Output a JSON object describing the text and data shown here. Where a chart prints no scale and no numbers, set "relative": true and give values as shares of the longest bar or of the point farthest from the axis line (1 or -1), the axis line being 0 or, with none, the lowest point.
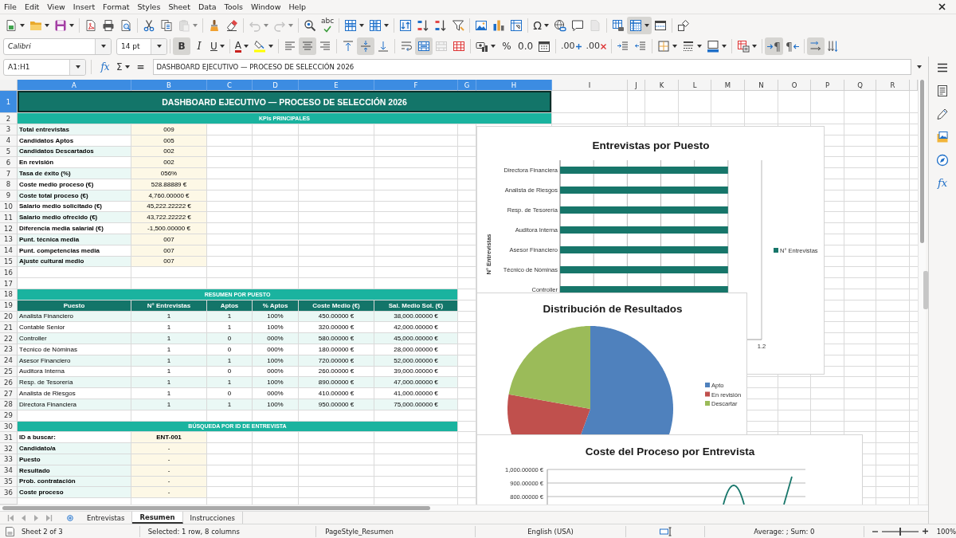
{
  "menu_bar": {
    "items": [
      "File",
      "Edit",
      "View",
      "Insert",
      "Format",
      "Styles",
      "Sheet",
      "Data",
      "Tools",
      "Window",
      "Help"
    ]
  },
  "standard_toolbar": [
    [
      {
        "kind": "new",
        "pressed": false,
        "disabled": false
      },
      {
        "kind": "open",
        "pressed": false,
        "disabled": false
      },
      {
        "kind": "save",
        "pressed": false,
        "disabled": false
      }
    ],
    [
      {
        "kind": "export_pdf",
        "pressed": false,
        "disabled": false
      },
      {
        "kind": "print",
        "pressed": false,
        "disabled": false
      },
      {
        "kind": "print_preview",
        "pressed": false,
        "disabled": false
      }
    ],
    [
      {
        "kind": "cut",
        "pressed": false,
        "disabled": false
      },
      {
        "kind": "copy",
        "pressed": false,
        "disabled": false
      },
      {
        "kind": "paste",
        "pressed": false,
        "disabled": true
      }
    ],
    [
      {
        "kind": "clone_formatting",
        "pressed": false,
        "disabled": false
      },
      {
        "kind": "clear_formatting",
        "pressed": false,
        "disabled": false
      }
    ],
    [
      {
        "kind": "undo",
        "pressed": false,
        "disabled": true
      },
      {
        "kind": "redo",
        "pressed": false,
        "disabled": true
      }
    ],
    [
      {
        "kind": "find_replace",
        "pressed": false,
        "disabled": false
      },
      {
        "kind": "spelling",
        "glyph": "abc",
        "pressed": false,
        "disabled": false
      }
    ],
    [
      {
        "kind": "insert_row",
        "pressed": false,
        "disabled": false
      },
      {
        "kind": "insert_column",
        "pressed": false,
        "disabled": false
      }
    ],
    [
      {
        "kind": "sort",
        "pressed": false,
        "disabled": false
      },
      {
        "kind": "sort_ascending",
        "pressed": false,
        "disabled": false
      },
      {
        "kind": "sort_descending",
        "pressed": false,
        "disabled": false
      },
      {
        "kind": "autofilter",
        "pressed": false,
        "disabled": false
      }
    ],
    [
      {
        "kind": "image",
        "pressed": false,
        "disabled": false
      },
      {
        "kind": "chart",
        "pressed": false,
        "disabled": false
      },
      {
        "kind": "pivot_table",
        "pressed": false,
        "disabled": false
      }
    ],
    [
      {
        "kind": "special_character",
        "glyph": "Ω",
        "pressed": false,
        "disabled": false
      },
      {
        "kind": "hyperlink",
        "pressed": false,
        "disabled": false
      },
      {
        "kind": "comment",
        "pressed": false,
        "disabled": false
      },
      {
        "kind": "header_footer",
        "pressed": false,
        "disabled": true
      }
    ],
    [
      {
        "kind": "print_area",
        "pressed": false,
        "disabled": false
      },
      {
        "kind": "freeze",
        "pressed": true,
        "disabled": false
      },
      {
        "kind": "split_window",
        "pressed": false,
        "disabled": false
      }
    ],
    [
      {
        "kind": "draw_functions",
        "pressed": false,
        "disabled": false
      }
    ]
  ],
  "formatting_toolbar": {
    "font_name": "Calibri",
    "font_size": "14 pt",
    "groups": [
      [
        {
          "kind": "bold",
          "glyph": "B",
          "pressed": true,
          "disabled": false
        },
        {
          "kind": "italic",
          "glyph": "I",
          "pressed": false,
          "disabled": false
        },
        {
          "kind": "underline",
          "glyph": "U",
          "pressed": false,
          "disabled": false
        }
      ],
      [
        {
          "kind": "font_color",
          "glyph": "A",
          "pressed": false,
          "disabled": false
        },
        {
          "kind": "highlight",
          "pressed": false,
          "disabled": false
        }
      ],
      [
        {
          "kind": "align_left",
          "pressed": false,
          "disabled": false
        },
        {
          "kind": "align_center",
          "pressed": true,
          "disabled": false
        },
        {
          "kind": "align_right",
          "pressed": false,
          "disabled": false
        }
      ],
      [
        {
          "kind": "align_top",
          "pressed": false,
          "disabled": false
        },
        {
          "kind": "align_middle",
          "pressed": true,
          "disabled": false
        },
        {
          "kind": "align_bottom",
          "pressed": false,
          "disabled": false
        }
      ],
      [
        {
          "kind": "wrap_text",
          "pressed": false,
          "disabled": false
        },
        {
          "kind": "merge_center",
          "pressed": true,
          "disabled": false
        },
        {
          "kind": "merge_cells",
          "pressed": false,
          "disabled": true
        },
        {
          "kind": "unmerge",
          "pressed": false,
          "disabled": false
        }
      ],
      [
        {
          "kind": "number_format",
          "pressed": false,
          "disabled": false
        },
        {
          "kind": "percent",
          "glyph": "%",
          "pressed": false,
          "disabled": false
        },
        {
          "kind": "number",
          "glyph": "0.0",
          "pressed": false,
          "disabled": false
        },
        {
          "kind": "date",
          "pressed": false,
          "disabled": false
        }
      ],
      [
        {
          "kind": "add_decimal",
          "glyph": ".00",
          "pressed": false,
          "disabled": false
        },
        {
          "kind": "delete_decimal",
          "glyph": ".00",
          "pressed": false,
          "disabled": false
        }
      ],
      [
        {
          "kind": "indent_increase",
          "pressed": false,
          "disabled": false
        },
        {
          "kind": "indent_decrease",
          "pressed": false,
          "disabled": false
        }
      ],
      [
        {
          "kind": "borders",
          "pressed": false,
          "disabled": false
        },
        {
          "kind": "border_style",
          "pressed": false,
          "disabled": false
        },
        {
          "kind": "border_color",
          "pressed": false,
          "disabled": false
        }
      ],
      [
        {
          "kind": "conditional",
          "pressed": false,
          "disabled": false
        }
      ],
      [
        {
          "kind": "left_to_right",
          "glyph": "¶",
          "pressed": true,
          "disabled": false
        },
        {
          "kind": "right_to_left",
          "glyph": "¶",
          "pressed": false,
          "disabled": false
        }
      ],
      [
        {
          "kind": "text_horizontal",
          "pressed": true,
          "disabled": false
        },
        {
          "kind": "text_vertical",
          "pressed": false,
          "disabled": false
        }
      ]
    ]
  },
  "formula_bar": {
    "name_box": "A1:H1",
    "buttons": [
      {
        "kind": "function_wizard",
        "glyph": "fx"
      },
      {
        "kind": "sum",
        "glyph": "Σ"
      },
      {
        "kind": "formula",
        "glyph": "="
      }
    ],
    "content": "DASHBOARD EJECUTIVO — PROCESO DE SELECCIÓN 2026"
  },
  "sheet": {
    "columns": [
      {
        "label": "A",
        "selected": true
      },
      {
        "label": "B",
        "selected": true
      },
      {
        "label": "C",
        "selected": true
      },
      {
        "label": "D",
        "selected": true
      },
      {
        "label": "E",
        "selected": true
      },
      {
        "label": "F",
        "selected": true
      },
      {
        "label": "G",
        "selected": true
      },
      {
        "label": "H",
        "selected": true
      },
      {
        "label": "I",
        "selected": false
      },
      {
        "label": "J",
        "selected": false
      },
      {
        "label": "K",
        "selected": false
      },
      {
        "label": "L",
        "selected": false
      },
      {
        "label": "M",
        "selected": false
      },
      {
        "label": "N",
        "selected": false
      },
      {
        "label": "O",
        "selected": false
      },
      {
        "label": "P",
        "selected": false
      },
      {
        "label": "Q",
        "selected": false
      },
      {
        "label": "R",
        "selected": false
      }
    ],
    "rows": [
      {
        "label": "1",
        "selected": true
      },
      {
        "label": "2",
        "selected": false
      },
      {
        "label": "3",
        "selected": false
      },
      {
        "label": "4",
        "selected": false
      },
      {
        "label": "5",
        "selected": false
      },
      {
        "label": "6",
        "selected": false
      },
      {
        "label": "7",
        "selected": false
      },
      {
        "label": "8",
        "selected": false
      },
      {
        "label": "9",
        "selected": false
      },
      {
        "label": "10",
        "selected": false
      },
      {
        "label": "11",
        "selected": false
      },
      {
        "label": "12",
        "selected": false
      },
      {
        "label": "13",
        "selected": false
      },
      {
        "label": "14",
        "selected": false
      },
      {
        "label": "15",
        "selected": false
      },
      {
        "label": "16",
        "selected": false
      },
      {
        "label": "17",
        "selected": false
      },
      {
        "label": "18",
        "selected": false
      },
      {
        "label": "19",
        "selected": false
      },
      {
        "label": "20",
        "selected": false
      },
      {
        "label": "21",
        "selected": false
      },
      {
        "label": "22",
        "selected": false
      },
      {
        "label": "23",
        "selected": false
      },
      {
        "label": "24",
        "selected": false
      },
      {
        "label": "25",
        "selected": false
      },
      {
        "label": "26",
        "selected": false
      },
      {
        "label": "27",
        "selected": false
      },
      {
        "label": "28",
        "selected": false
      },
      {
        "label": "29",
        "selected": false
      },
      {
        "label": "30",
        "selected": false
      },
      {
        "label": "31",
        "selected": false
      },
      {
        "label": "32",
        "selected": false
      },
      {
        "label": "33",
        "selected": false
      },
      {
        "label": "34",
        "selected": false
      },
      {
        "label": "35",
        "selected": false
      },
      {
        "label": "36",
        "selected": false
      }
    ],
    "title": "DASHBOARD EJECUTIVO — PROCESO DE SELECCIÓN 2026",
    "kpis": {
      "heading": "KPIs PRINCIPALES",
      "items": [
        {
          "label": "Total entrevistas",
          "value": "009"
        },
        {
          "label": "Candidatos Aptos",
          "value": "005"
        },
        {
          "label": "Candidatos Descartados",
          "value": "002"
        },
        {
          "label": "En revisión",
          "value": "002"
        },
        {
          "label": "Tasa de éxito (%)",
          "value": "056%"
        },
        {
          "label": "Coste medio proceso (€)",
          "value": "528.88889 €"
        },
        {
          "label": "Coste total proceso (€)",
          "value": "4,760.00000 €"
        },
        {
          "label": "Salario medio solicitado (€)",
          "value": "45,222.22222 €"
        },
        {
          "label": "Salario medio ofrecido (€)",
          "value": "43,722.22222 €"
        },
        {
          "label": "Diferencia media salarial (€)",
          "value": "-1,500.00000 €"
        },
        {
          "label": "Punt. técnica media",
          "value": "007"
        },
        {
          "label": "Punt. competencias media",
          "value": "007"
        },
        {
          "label": "Ajuste cultural medio",
          "value": "007"
        }
      ]
    },
    "summary": {
      "heading": "RESUMEN POR PUESTO",
      "columns": [
        "Puesto",
        "N° Entrevistas",
        "Aptos",
        "% Aptos",
        "Coste Medio (€)",
        "Sal. Medio Sol. (€)"
      ],
      "rows": [
        [
          "Analista Financiero",
          "1",
          "1",
          "100%",
          "450.00000 €",
          "38,000.00000 €"
        ],
        [
          "Contable Senior",
          "1",
          "1",
          "100%",
          "320.00000 €",
          "42,000.00000 €"
        ],
        [
          "Controller",
          "1",
          "0",
          "000%",
          "580.00000 €",
          "45,000.00000 €"
        ],
        [
          "Técnico de Nóminas",
          "1",
          "0",
          "000%",
          "180.00000 €",
          "28,000.00000 €"
        ],
        [
          "Asesor Financiero",
          "1",
          "1",
          "100%",
          "720.00000 €",
          "52,000.00000 €"
        ],
        [
          "Auditora Interna",
          "1",
          "0",
          "000%",
          "260.00000 €",
          "39,000.00000 €"
        ],
        [
          "Resp. de Tesorería",
          "1",
          "1",
          "100%",
          "890.00000 €",
          "47,000.00000 €"
        ],
        [
          "Analista de Riesgos",
          "1",
          "0",
          "000%",
          "410.00000 €",
          "41,000.00000 €"
        ],
        [
          "Directora Financiera",
          "1",
          "1",
          "100%",
          "950.00000 €",
          "75,000.00000 €"
        ]
      ]
    },
    "lookup": {
      "heading": "BÚSQUEDA POR ID DE ENTREVISTA",
      "items": [
        {
          "label": "ID a buscar:",
          "value": "ENT-001"
        },
        {
          "label": "Candidato/a",
          "value": "-"
        },
        {
          "label": "Puesto",
          "value": "-"
        },
        {
          "label": "Resultado",
          "value": "-"
        },
        {
          "label": "Prob. contratación",
          "value": "-"
        },
        {
          "label": "Coste proceso",
          "value": "-"
        }
      ]
    }
  },
  "charts": [
    {
      "kind": "chart",
      "chart_data": {
        "type": "bar",
        "orientation": "horizontal",
        "relative": true,
        "title": "Entrevistas por Puesto",
        "ylabel": "N° Entrevistas",
        "categories": [
          "Directora Financiera",
          "Analista de Riesgos",
          "Resp. de Tesorería",
          "Auditora Interna",
          "Asesor Financiero",
          "Técnico de Nóminas",
          "Controller"
        ],
        "series": [
          {
            "name": "N° Entrevistas",
            "color": "#17766a",
            "values": [
              1,
              1,
              1,
              1,
              1,
              1,
              1
            ]
          }
        ],
        "annotations": [
          {
            "text": "1.2"
          }
        ],
        "legend": "right"
      }
    },
    {
      "kind": "chart",
      "chart_data": {
        "type": "pie",
        "title": "Distribución de Resultados",
        "categories": [
          "Apto",
          "En revisión",
          "Descartar"
        ],
        "values": [
          55.6,
          22.2,
          22.2
        ],
        "colors": [
          "#4f81bd",
          "#c0504d",
          "#9bbb59"
        ],
        "legend": "right"
      }
    },
    {
      "kind": "picture",
      "title": "Coste del Proceso por Entrevista",
      "axis_labels": [
        "1,000.00000 €",
        "900.00000 €",
        "800.00000 €"
      ]
    }
  ],
  "sidebar": {
    "items": [
      {
        "kind": "menu"
      },
      {
        "kind": "properties"
      },
      {
        "kind": "styles"
      },
      {
        "kind": "gallery"
      },
      {
        "kind": "navigator"
      },
      {
        "kind": "functions",
        "glyph": "fx"
      }
    ]
  },
  "sheet_tabs": [
    {
      "label": "Entrevistas",
      "selected": false
    },
    {
      "label": "Resumen",
      "selected": true
    },
    {
      "label": "Instrucciones",
      "selected": false
    }
  ],
  "status_bar": {
    "sheet": "Sheet 2 of 3",
    "selection": "Selected: 1 row, 8 columns",
    "page_style": "PageStyle_Resumen",
    "language": "English (USA)",
    "summary": "Average: ; Sum: 0",
    "zoom": {
      "level": 0.5,
      "reading": "100%"
    }
  }
}
